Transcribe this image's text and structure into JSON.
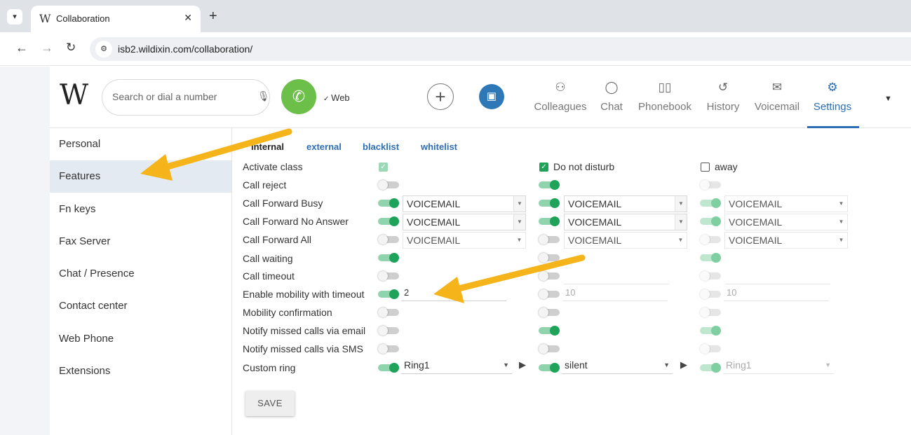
{
  "browser": {
    "tab_title": "Collaboration",
    "tab_favicon": "W",
    "new_tab": "+",
    "url": "isb2.wildixin.com/collaboration/"
  },
  "header": {
    "logo": "W",
    "search_placeholder": "Search or dial a number",
    "device": "Web",
    "nav": [
      {
        "label": "Colleagues",
        "icon": "colleagues-icon"
      },
      {
        "label": "Chat",
        "icon": "chat-icon"
      },
      {
        "label": "Phonebook",
        "icon": "phonebook-icon"
      },
      {
        "label": "History",
        "icon": "history-icon"
      },
      {
        "label": "Voicemail",
        "icon": "voicemail-icon"
      },
      {
        "label": "Settings",
        "icon": "settings-icon"
      }
    ]
  },
  "sidebar": {
    "items": [
      "Personal",
      "Features",
      "Fn keys",
      "Fax Server",
      "Chat / Presence",
      "Contact center",
      "Web Phone",
      "Extensions"
    ],
    "active": "Features"
  },
  "features": {
    "tabs": [
      "internal",
      "external",
      "blacklist",
      "whitelist"
    ],
    "active_tab": "internal",
    "columns": [
      "Activate class",
      "Do not disturb",
      "away"
    ],
    "rows": {
      "activate_class": "Activate class",
      "call_reject": "Call reject",
      "cf_busy": "Call Forward Busy",
      "cf_no_answer": "Call Forward No Answer",
      "cf_all": "Call Forward All",
      "call_waiting": "Call waiting",
      "call_timeout": "Call timeout",
      "mobility_timeout": "Enable mobility with timeout",
      "mobility_confirm": "Mobility confirmation",
      "notify_email": "Notify missed calls via email",
      "notify_sms": "Notify missed calls via SMS",
      "custom_ring": "Custom ring"
    },
    "forward_value": "VOICEMAIL",
    "mobility_values": [
      "2",
      "10",
      "10"
    ],
    "ring_values": [
      "Ring1",
      "silent",
      "Ring1"
    ],
    "save_label": "SAVE"
  },
  "colors": {
    "accent": "#2d6db4",
    "toggle_on": "#1fa35a",
    "call_green": "#6cc04a",
    "annotation_arrow": "#f5b41a"
  }
}
